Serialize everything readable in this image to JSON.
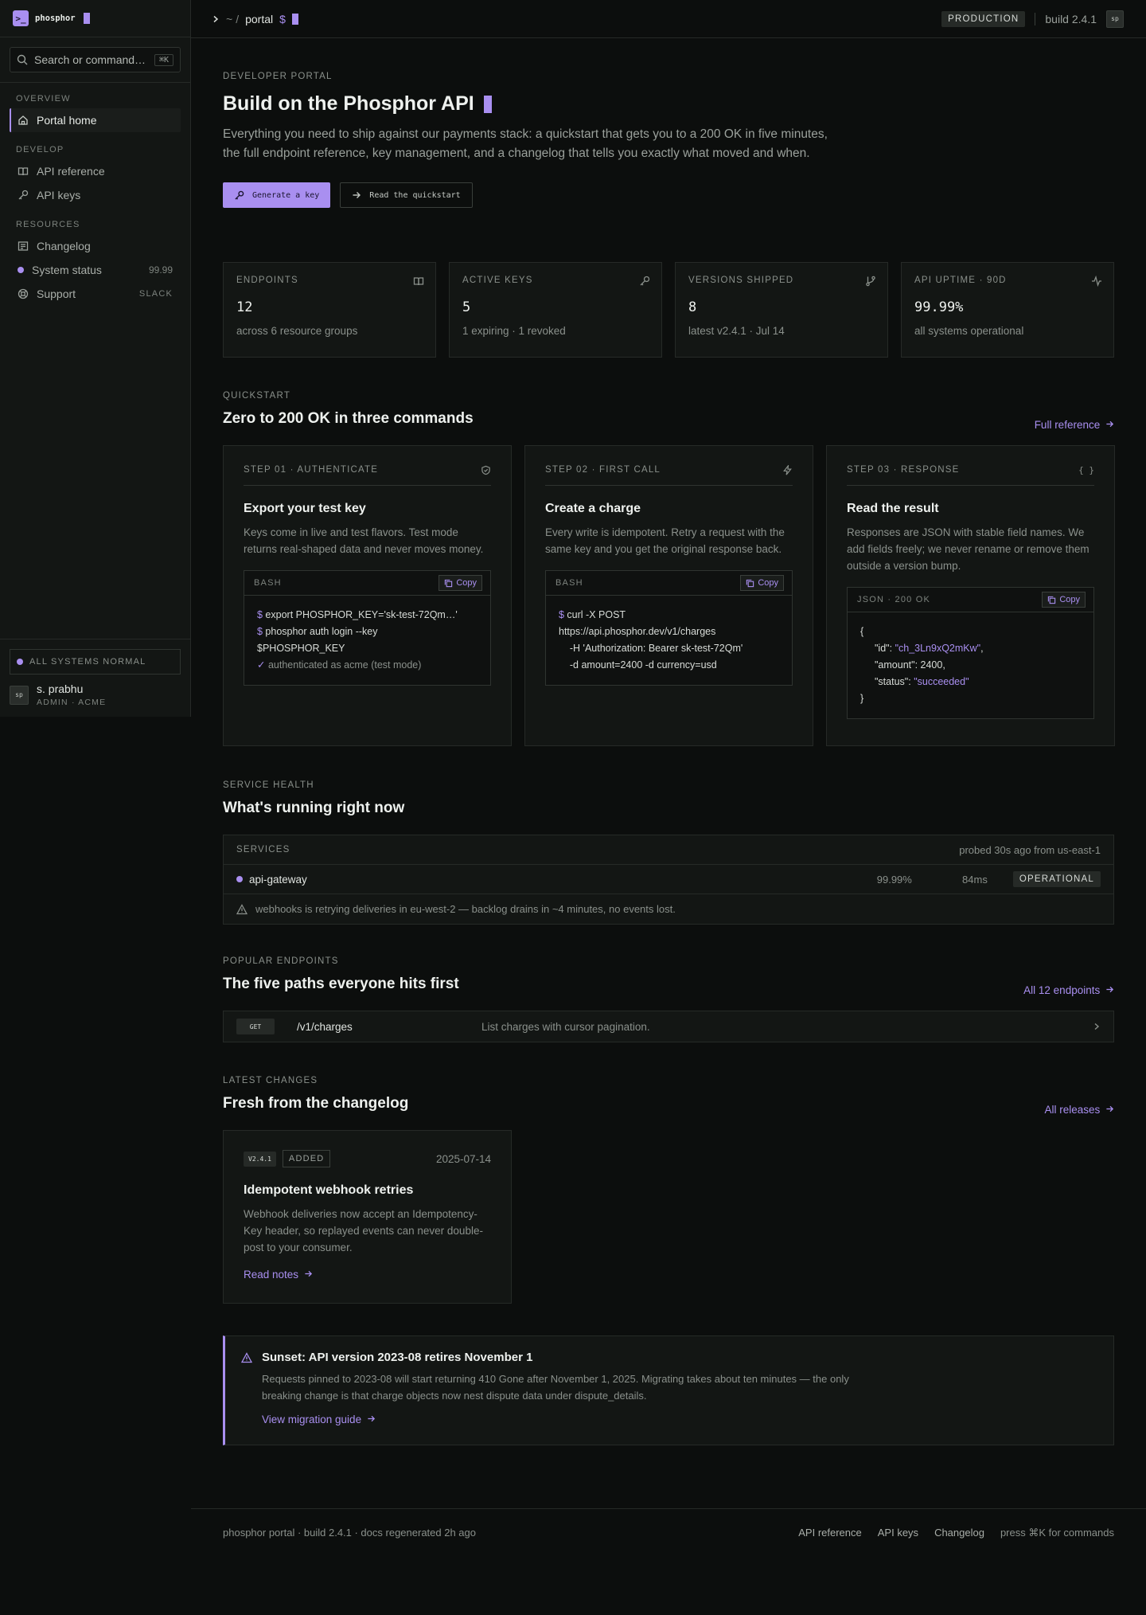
{
  "brand": {
    "name": "phosphor",
    "logo_glyph": ">_"
  },
  "search": {
    "placeholder": "Search or command…",
    "shortcut": "⌘K"
  },
  "nav": {
    "sections": [
      {
        "title": "OVERVIEW",
        "items": [
          {
            "label": "Portal home",
            "icon": "home-icon",
            "active": true
          }
        ]
      },
      {
        "title": "DEVELOP",
        "items": [
          {
            "label": "API reference",
            "icon": "book-icon"
          },
          {
            "label": "API keys",
            "icon": "key-icon"
          }
        ]
      },
      {
        "title": "RESOURCES",
        "items": [
          {
            "label": "Changelog",
            "icon": "changelog-icon"
          },
          {
            "label": "System status",
            "icon": "status-dot-icon",
            "right": "99.99"
          },
          {
            "label": "Support",
            "icon": "lifebuoy-icon",
            "right": "SLACK"
          }
        ]
      }
    ]
  },
  "sidebar_footer": {
    "status": "ALL SYSTEMS NORMAL",
    "user": {
      "initials": "sp",
      "name": "s. prabhu",
      "role": "ADMIN · ACME"
    }
  },
  "topbar": {
    "crumb_home": "~",
    "crumb_sep": "/",
    "crumb_current": "portal",
    "prompt": "$",
    "env": "PRODUCTION",
    "build": "build 2.4.1",
    "avatar": "sp"
  },
  "hero": {
    "eyebrow": "DEVELOPER PORTAL",
    "title": "Build on the Phosphor API",
    "lede": "Everything you need to ship against our payments stack: a quickstart that gets you to a 200 OK in five minutes, the full endpoint reference, key management, and a changelog that tells you exactly what moved and when.",
    "primary_cta": "Generate a key",
    "secondary_cta": "Read the quickstart"
  },
  "stats": [
    {
      "label": "ENDPOINTS",
      "value": "12",
      "sub": "across 6 resource groups",
      "icon": "book-icon"
    },
    {
      "label": "ACTIVE KEYS",
      "value": "5",
      "sub": "1 expiring · 1 revoked",
      "icon": "key-icon"
    },
    {
      "label": "VERSIONS SHIPPED",
      "value": "8",
      "sub": "latest v2.4.1 · Jul 14",
      "icon": "git-branch-icon"
    },
    {
      "label": "API UPTIME · 90D",
      "value": "99.99%",
      "sub": "all systems operational",
      "icon": "activity-icon"
    }
  ],
  "quickstart": {
    "eyebrow": "QUICKSTART",
    "title": "Zero to 200 OK in three commands",
    "link": "Full reference",
    "steps": [
      {
        "label": "STEP 01 · AUTHENTICATE",
        "icon": "shield-icon",
        "title": "Export your test key",
        "desc": "Keys come in live and test flavors. Test mode returns real-shaped data and never moves money.",
        "lang": "BASH",
        "copy": "Copy",
        "lines": [
          {
            "prompt": "$",
            "text": " export PHOSPHOR_KEY='sk-test-72Qm…'"
          },
          {
            "prompt": "$",
            "text": " phosphor auth login --key"
          },
          {
            "prompt": "",
            "text": "$PHOSPHOR_KEY"
          },
          {
            "prompt": "✓",
            "text": " authenticated as acme (test mode)",
            "muted": true
          }
        ]
      },
      {
        "label": "STEP 02 · FIRST CALL",
        "icon": "bolt-icon",
        "title": "Create a charge",
        "desc": "Every write is idempotent. Retry a request with the same key and you get the original response back.",
        "lang": "BASH",
        "copy": "Copy",
        "lines": [
          {
            "prompt": "$",
            "text": " curl -X POST"
          },
          {
            "prompt": "",
            "text": "https://api.phosphor.dev/v1/charges"
          },
          {
            "prompt": "",
            "text": "    -H 'Authorization: Bearer sk-test-72Qm'"
          },
          {
            "prompt": "",
            "text": "    -d amount=2400 -d currency=usd"
          }
        ]
      },
      {
        "label": "STEP 03 · RESPONSE",
        "icon": "braces-icon",
        "title": "Read the result",
        "desc": "Responses are JSON with stable field names. We add fields freely; we never rename or remove them outside a version bump.",
        "lang": "JSON · 200 OK",
        "copy": "Copy",
        "json": {
          "open": "{",
          "id_key": "\"id\"",
          "id_val": "\"ch_3Ln9xQ2mKw\"",
          "amount_key": "\"amount\"",
          "amount_val": "2400,",
          "status_key": "\"status\"",
          "status_val": "\"succeeded\"",
          "close": "}"
        }
      }
    ]
  },
  "health": {
    "eyebrow": "SERVICE HEALTH",
    "title": "What's running right now",
    "header_label": "SERVICES",
    "header_probe": "probed 30s ago from us-east-1",
    "service": {
      "name": "api-gateway",
      "uptime": "99.99%",
      "latency": "84ms",
      "status": "OPERATIONAL"
    },
    "notice": "webhooks is retrying deliveries in eu-west-2 — backlog drains in ~4 minutes, no events lost."
  },
  "endpoints": {
    "eyebrow": "POPULAR ENDPOINTS",
    "title": "The five paths everyone hits first",
    "link": "All 12 endpoints",
    "rows": [
      {
        "method": "GET",
        "path": "/v1/charges",
        "desc": "List charges with cursor pagination."
      }
    ]
  },
  "changes": {
    "eyebrow": "LATEST CHANGES",
    "title": "Fresh from the changelog",
    "link": "All releases",
    "card": {
      "version": "V2.4.1",
      "kind": "ADDED",
      "date": "2025-07-14",
      "title": "Idempotent webhook retries",
      "desc": "Webhook deliveries now accept an Idempotency-Key header, so replayed events can never double-post to your consumer.",
      "link": "Read notes"
    }
  },
  "sunset": {
    "title": "Sunset: API version 2023-08 retires November 1",
    "desc": "Requests pinned to 2023-08 will start returning 410 Gone after November 1, 2025. Migrating takes about ten minutes — the only breaking change is that charge objects now nest dispute data under dispute_details.",
    "link": "View migration guide"
  },
  "footer": {
    "left": "phosphor portal · build 2.4.1 · docs regenerated 2h ago",
    "links": [
      "API reference",
      "API keys",
      "Changelog",
      "press ⌘K for commands"
    ]
  },
  "colors": {
    "accent": "#a98ff0",
    "bg": "#0c0e0d",
    "panel": "#131614",
    "border": "#262a27"
  }
}
